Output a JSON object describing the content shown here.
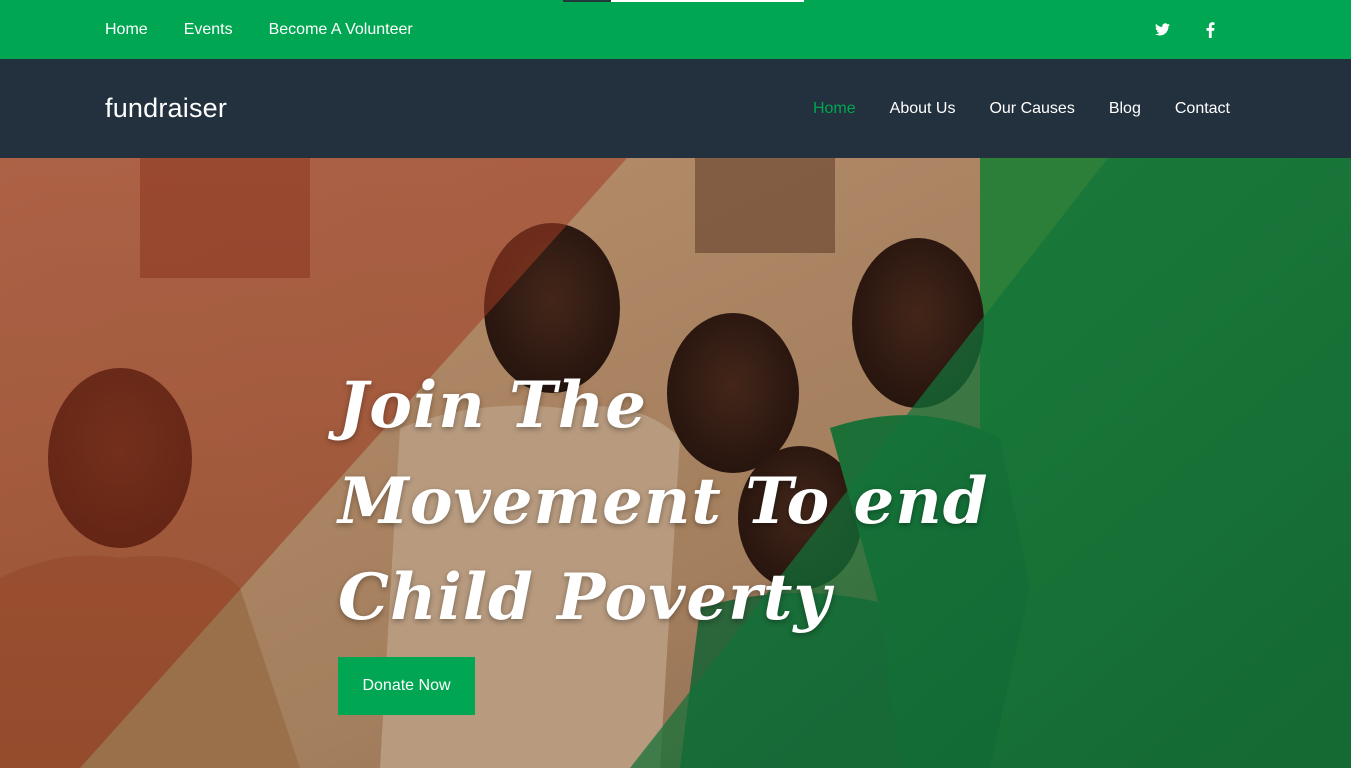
{
  "topbar": {
    "links": [
      "Home",
      "Events",
      "Become A Volunteer"
    ],
    "social": [
      "twitter-icon",
      "facebook-icon"
    ],
    "background": "#00a651"
  },
  "header": {
    "brand": "fundraiser",
    "nav": [
      "Home",
      "About Us",
      "Our Causes",
      "Blog",
      "Contact"
    ],
    "active": "Home",
    "background": "#22313d",
    "accent": "#00a651"
  },
  "hero": {
    "title_lines": [
      "Join The",
      "Movement To end",
      "Child Poverty"
    ],
    "button_label": "Donate Now",
    "overlay_colors": {
      "left": "#b23a1e",
      "middle": "#c9a27a",
      "right": "#0b7a3a"
    }
  }
}
